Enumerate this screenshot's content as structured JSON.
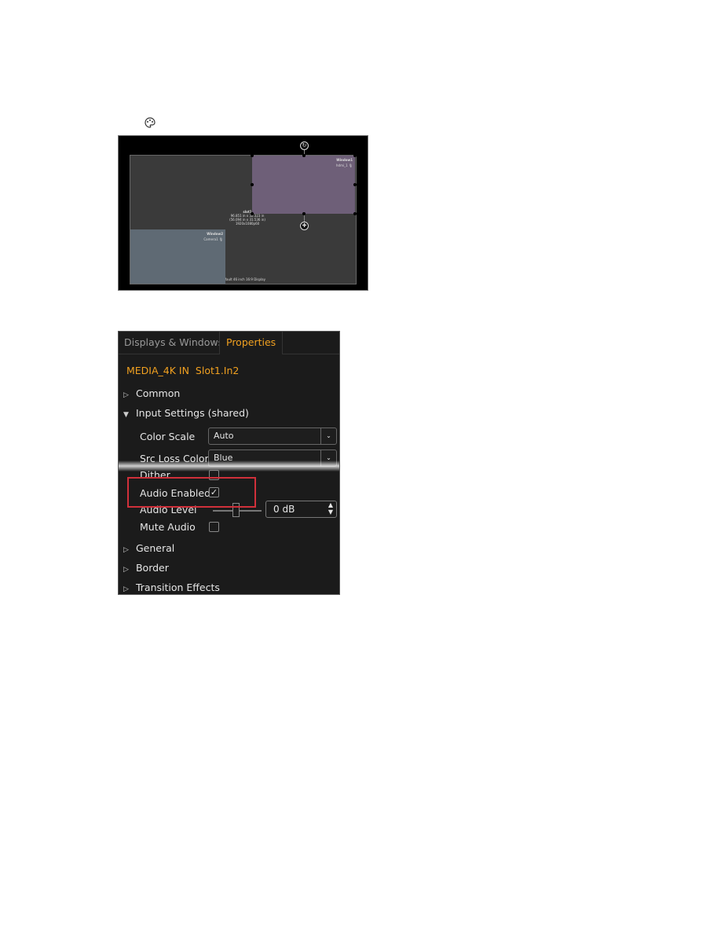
{
  "toolbar": {
    "palette_icon": "palette-icon"
  },
  "canvas": {
    "display_label": "Default 46 inch 16:9 Display",
    "slot": {
      "name": "slot1",
      "size": "96.851 in x 32.323 in",
      "size2": "(56.094 in x 31.536 in)",
      "format": "1920x1080p60"
    },
    "window1": {
      "name": "Window1",
      "source": "hdmi_1",
      "color": "#6e5f78"
    },
    "window2": {
      "name": "Window2",
      "source": "Camera1",
      "color": "#5f6a74"
    }
  },
  "panel": {
    "tabs": [
      {
        "label": "Displays & Windows",
        "active": false
      },
      {
        "label": "Properties",
        "active": true
      }
    ],
    "device": "MEDIA_4K IN",
    "slot": "Slot1.In2",
    "accent": "#f0a020",
    "sections": {
      "common": "Common",
      "input": "Input Settings (shared)",
      "general": "General",
      "border": "Border",
      "transition": "Transition Effects"
    },
    "fields": {
      "color_scale": {
        "label": "Color Scale",
        "value": "Auto"
      },
      "src_loss": {
        "label": "Src Loss Color",
        "value": "Blue"
      },
      "dither": {
        "label": "Dither",
        "checked": false
      },
      "audio_enabled": {
        "label": "Audio Enabled",
        "checked": true
      },
      "audio_level": {
        "label": "Audio Level",
        "value": "0 dB",
        "slider": 0.5
      },
      "mute_audio": {
        "label": "Mute Audio",
        "checked": false
      }
    },
    "highlight_color": "#d0303a"
  }
}
